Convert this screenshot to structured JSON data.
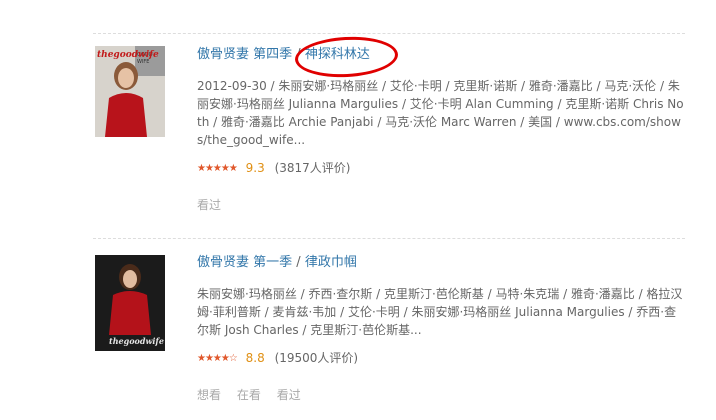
{
  "results": [
    {
      "title": "傲骨贤妻 第四季",
      "separator": "/",
      "alias": "神探科林达",
      "meta": "2012-09-30 / 朱丽安娜·玛格丽丝 / 艾伦·卡明 / 克里斯·诺斯 / 雅奇·潘嘉比 / 马克·沃伦 / 朱丽安娜·玛格丽丝 Julianna Margulies / 艾伦·卡明 Alan Cumming / 克里斯·诺斯 Chris Noth / 雅奇·潘嘉比 Archie Panjabi / 马克·沃伦 Marc Warren / 美国 / www.cbs.com/shows/the_good_wife...",
      "stars": "★★★★★",
      "score": "9.3",
      "count": "(3817人评价)",
      "actions": [
        "看过"
      ],
      "poster_text": "thegoodwife"
    },
    {
      "title": "傲骨贤妻 第一季",
      "separator": "/",
      "alias": "律政巾帼",
      "meta": "朱丽安娜·玛格丽丝 / 乔西·查尔斯 / 克里斯汀·芭伦斯基 / 马特·朱克瑞 / 雅奇·潘嘉比 / 格拉汉姆·菲利普斯 / 麦肯兹·韦加 / 艾伦·卡明 / 朱丽安娜·玛格丽丝 Julianna Margulies / 乔西·查尔斯 Josh Charles / 克里斯汀·芭伦斯基...",
      "stars": "★★★★☆",
      "score": "8.8",
      "count": "(19500人评价)",
      "actions": [
        "想看",
        "在看",
        "看过"
      ],
      "poster_text": "thegoodwife"
    }
  ],
  "colors": {
    "link": "#3377aa",
    "annotation": "#e00000",
    "star": "#e0582c"
  }
}
